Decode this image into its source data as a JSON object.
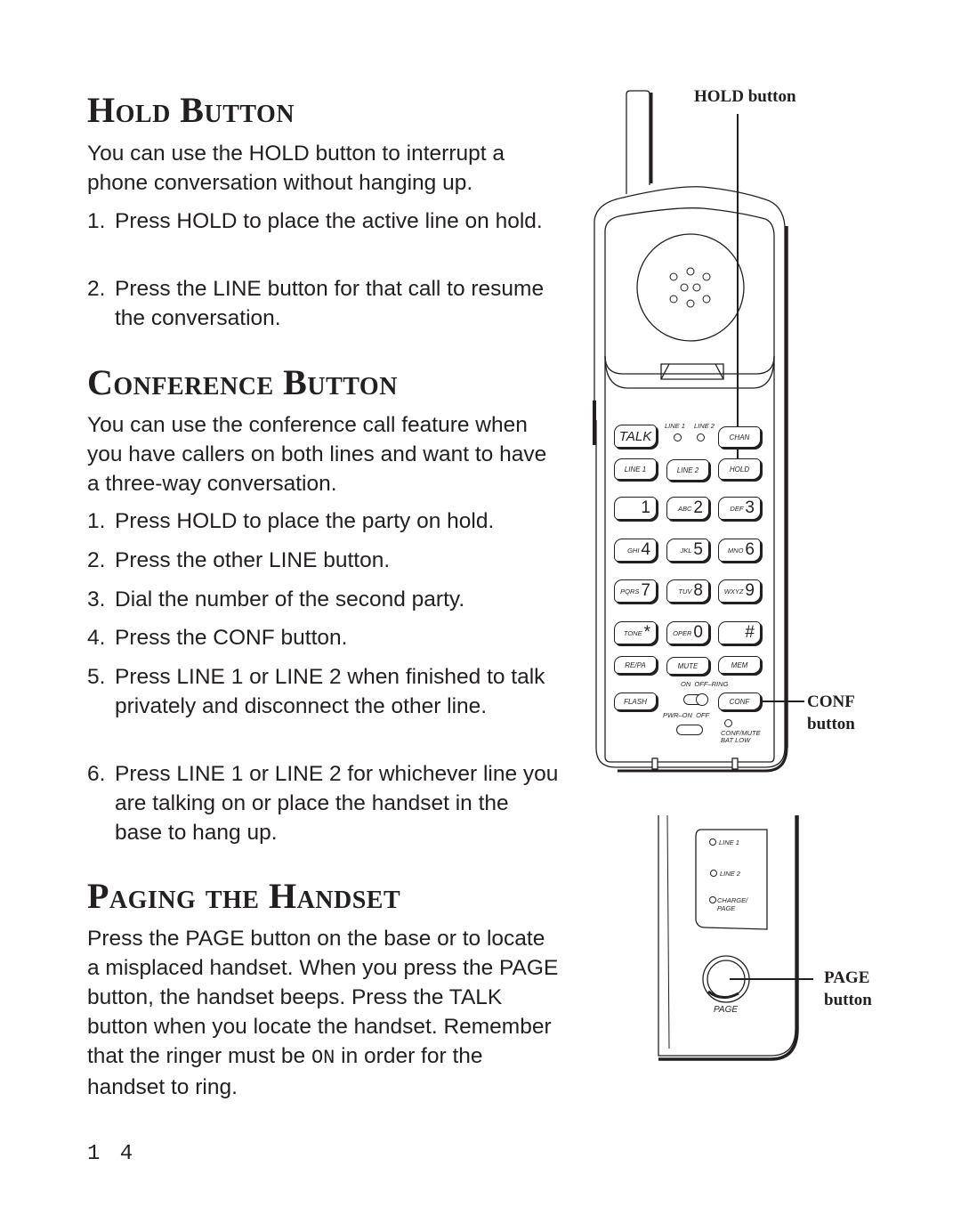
{
  "sections": {
    "hold": {
      "title": "Hold Button",
      "intro": "You can use the HOLD button to interrupt a phone conversation without hanging up.",
      "steps": [
        {
          "num": "1.",
          "text": "Press HOLD to place the active line on hold."
        },
        {
          "num": "2.",
          "text": "Press the LINE button for that call to resume the conversation."
        }
      ]
    },
    "conference": {
      "title": "Conference Button",
      "intro": "You can use the conference call feature when you have callers on both lines and want to have a three-way conversation.",
      "steps": [
        {
          "num": "1.",
          "text": "Press HOLD to place the party on hold."
        },
        {
          "num": "2.",
          "text": "Press the other LINE button."
        },
        {
          "num": "3.",
          "text": "Dial the number of the second party."
        },
        {
          "num": "4.",
          "text": "Press the CONF button."
        },
        {
          "num": "5.",
          "text": "Press LINE 1 or LINE 2 when finished to talk privately and disconnect the other line."
        },
        {
          "num": "6.",
          "text": "Press LINE 1 or LINE 2 for whichever line you are talking on or place the handset in the base to hang up."
        }
      ]
    },
    "paging": {
      "title": "Paging the Handset",
      "body": "Press the PAGE button on the base or to locate a misplaced handset. When you press the PAGE button, the handset beeps. Press the TALK button when you locate the handset. Remember that the ringer must be",
      "on_word": "ON",
      "body_end": " in order for the handset to ring."
    }
  },
  "page_number": "14",
  "figure": {
    "callouts": {
      "hold": "HOLD button",
      "conf_1": "CONF",
      "conf_2": "button",
      "page_1": "PAGE",
      "page_2": "button"
    },
    "handset": {
      "talk": "TALK",
      "led_line1": "LINE 1",
      "led_line2": "LINE 2",
      "chan": "CHAN",
      "line1": "LINE 1",
      "line2": "LINE 2",
      "hold": "HOLD",
      "keys": [
        {
          "sub": "",
          "main": "1"
        },
        {
          "sub": "ABC",
          "main": "2"
        },
        {
          "sub": "DEF",
          "main": "3"
        },
        {
          "sub": "GHI",
          "main": "4"
        },
        {
          "sub": "JKL",
          "main": "5"
        },
        {
          "sub": "MNO",
          "main": "6"
        },
        {
          "sub": "PQRS",
          "main": "7"
        },
        {
          "sub": "TUV",
          "main": "8"
        },
        {
          "sub": "WXYZ",
          "main": "9"
        },
        {
          "sub": "TONE",
          "main": "*"
        },
        {
          "sub": "OPER",
          "main": "0"
        },
        {
          "sub": "",
          "main": "#"
        }
      ],
      "repa": "RE/PA",
      "mute": "MUTE",
      "mem": "MEM",
      "flash": "FLASH",
      "conf": "CONF",
      "switch_top": "ON  OFF–RING",
      "switch_bottom": "PWR–ON  OFF",
      "conf_mute_1": "CONF/MUTE",
      "conf_mute_2": "BAT LOW"
    },
    "base": {
      "led_line1": "LINE 1",
      "led_line2": "LINE 2",
      "led_charge_1": "CHARGE/",
      "led_charge_2": "PAGE",
      "page": "PAGE"
    }
  }
}
